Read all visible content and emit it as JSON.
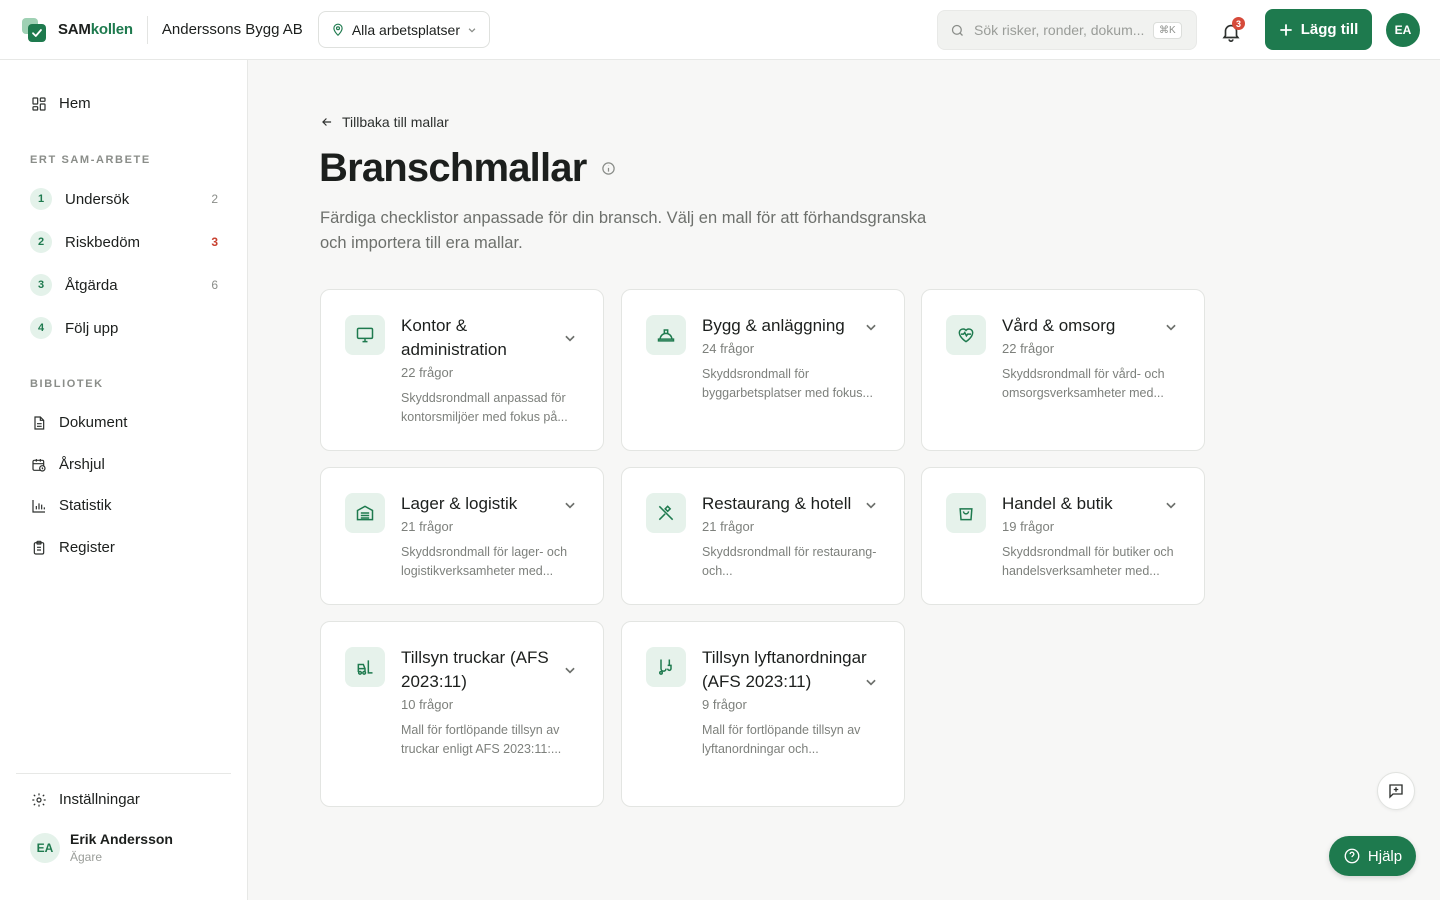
{
  "brand": {
    "name_part1": "SAM",
    "name_part2": "kollen",
    "company": "Anderssons Bygg AB"
  },
  "header": {
    "workplace_label": "Alla arbetsplatser",
    "search_placeholder": "Sök risker, ronder, dokum...",
    "search_shortcut": "⌘K",
    "notification_count": "3",
    "add_label": "Lägg till",
    "avatar_initials": "EA"
  },
  "sidebar": {
    "home_label": "Hem",
    "section_work": "ERT SAM-ARBETE",
    "steps": [
      {
        "num": "1",
        "label": "Undersök",
        "count": "2"
      },
      {
        "num": "2",
        "label": "Riskbedöm",
        "count": "3"
      },
      {
        "num": "3",
        "label": "Åtgärda",
        "count": "6"
      },
      {
        "num": "4",
        "label": "Följ upp",
        "count": ""
      }
    ],
    "section_library": "BIBLIOTEK",
    "library_items": [
      "Dokument",
      "Årshjul",
      "Statistik",
      "Register"
    ],
    "settings_label": "Inställningar",
    "user": {
      "initials": "EA",
      "name": "Erik Andersson",
      "role": "Ägare"
    }
  },
  "main": {
    "back_label": "Tillbaka till mallar",
    "title": "Branschmallar",
    "description": "Färdiga checklistor anpassade för din bransch. Välj en mall för att förhandsgranska och importera till era mallar.",
    "cards": [
      {
        "title": "Kontor & administration",
        "count": "22 frågor",
        "desc": "Skyddsrondmall anpassad för kontorsmiljöer med fokus på...",
        "icon": "monitor-icon"
      },
      {
        "title": "Bygg & anläggning",
        "count": "24 frågor",
        "desc": "Skyddsrondmall för byggarbetsplatser med fokus...",
        "icon": "hard-hat-icon"
      },
      {
        "title": "Vård & omsorg",
        "count": "22 frågor",
        "desc": "Skyddsrondmall för vård- och omsorgsverksamheter med...",
        "icon": "heart-pulse-icon"
      },
      {
        "title": "Lager & logistik",
        "count": "21 frågor",
        "desc": "Skyddsrondmall för lager- och logistikverksamheter med...",
        "icon": "warehouse-icon"
      },
      {
        "title": "Restaurang & hotell",
        "count": "21 frågor",
        "desc": "Skyddsrondmall för restaurang- och...",
        "icon": "utensils-icon"
      },
      {
        "title": "Handel & butik",
        "count": "19 frågor",
        "desc": "Skyddsrondmall för butiker och handelsverksamheter med...",
        "icon": "shopping-bag-icon"
      },
      {
        "title": "Tillsyn truckar (AFS 2023:11)",
        "count": "10 frågor",
        "desc": "Mall för fortlöpande tillsyn av truckar enligt AFS 2023:11:...",
        "icon": "forklift-icon"
      },
      {
        "title": "Tillsyn lyftanordningar (AFS 2023:11)",
        "count": "9 frågor",
        "desc": "Mall för fortlöpande tillsyn av lyftanordningar och...",
        "icon": "crane-hook-icon"
      }
    ]
  },
  "help_label": "Hjälp",
  "colors": {
    "accent": "#1e7a4e",
    "accent_soft": "#e6f2eb",
    "warning": "#c8402f"
  }
}
